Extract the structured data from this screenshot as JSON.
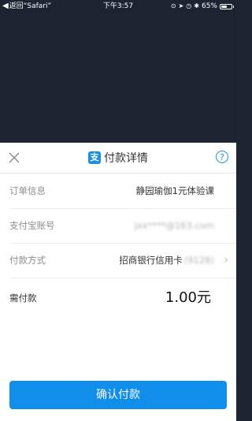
{
  "status_bar": {
    "back_label": "返回“Safari”",
    "time": "下午3:57",
    "battery": "65%",
    "battery_level": 0.65
  },
  "sheet": {
    "title": "付款详情",
    "logo_glyph": "支",
    "help_glyph": "?",
    "rows": [
      {
        "label": "订单信息",
        "value": "静园瑜伽1元体验课"
      },
      {
        "label": "支付宝账号",
        "value": "jxx****@163.com"
      },
      {
        "label": "付款方式",
        "value": "招商银行信用卡",
        "value_masked": "(9128)"
      }
    ],
    "amount_label": "需付款",
    "amount_value": "1.00元",
    "confirm_label": "确认付款"
  },
  "colors": {
    "accent": "#108ee9",
    "backdrop": "#1e2332"
  }
}
